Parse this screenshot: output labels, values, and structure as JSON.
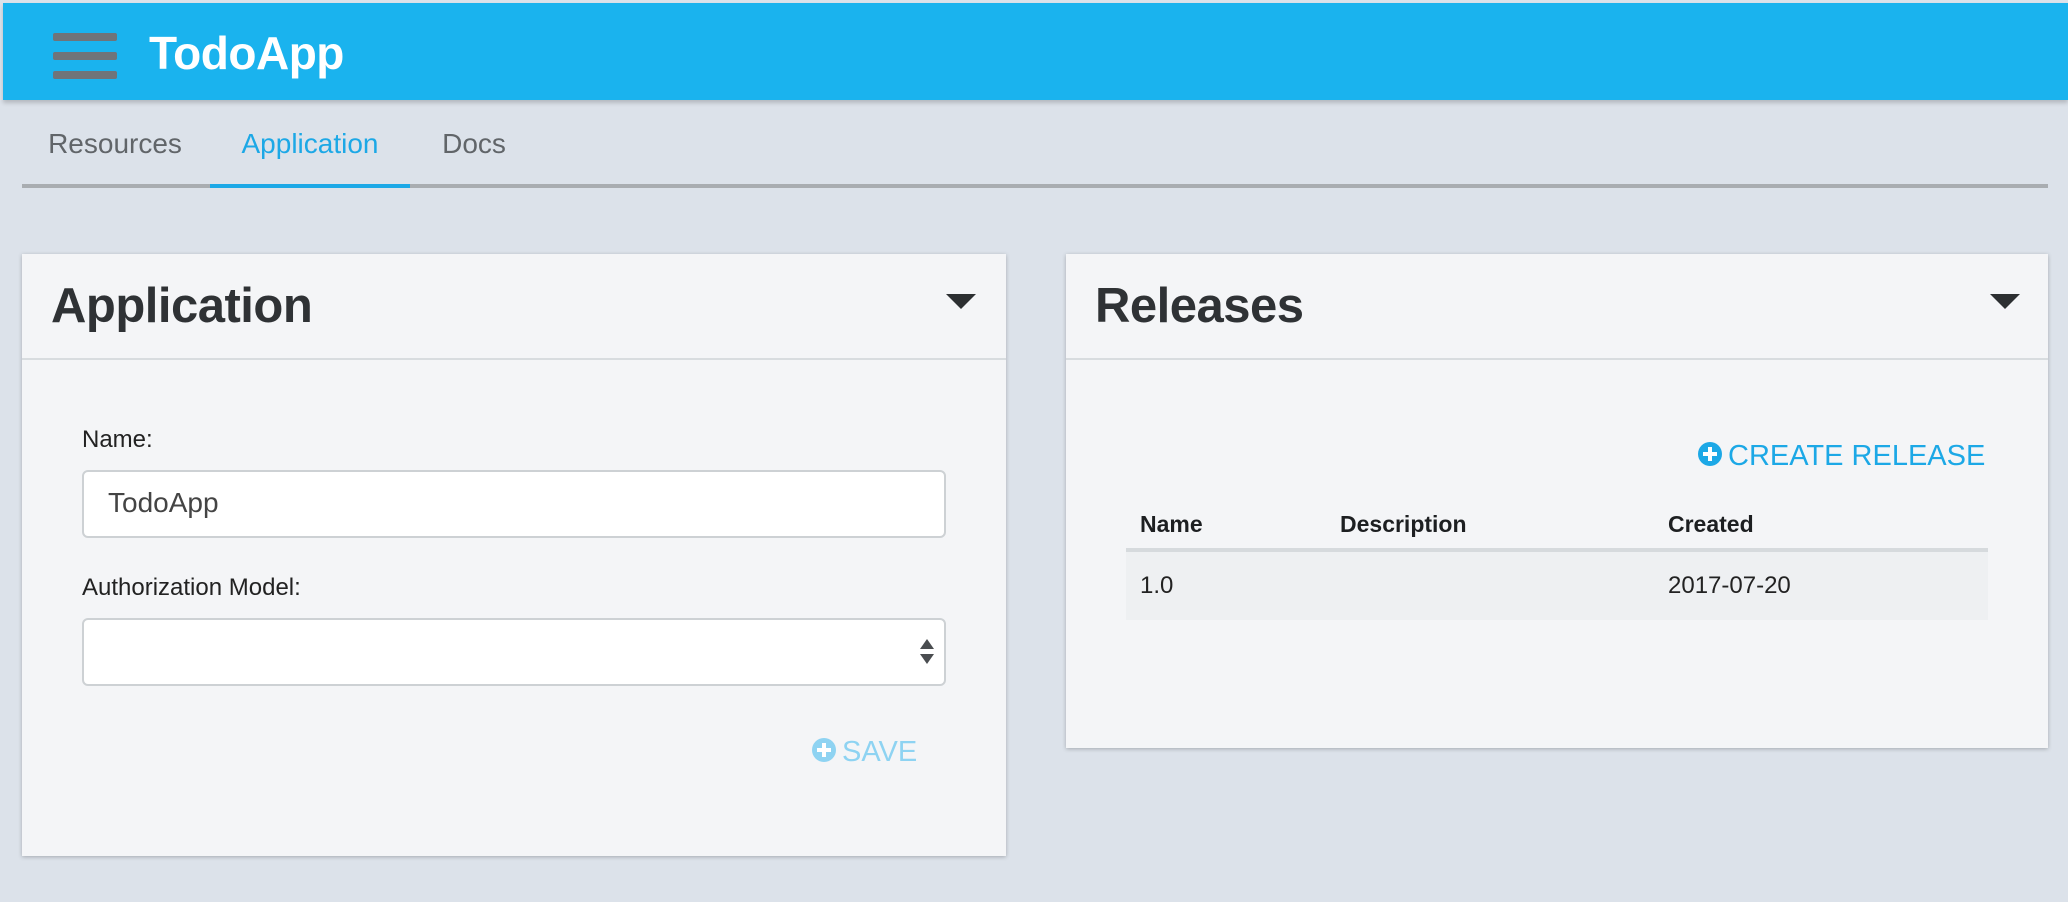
{
  "header": {
    "menu_icon": "hamburger-menu-icon",
    "title": "TodoApp",
    "background": "#1ab3ee"
  },
  "tabs": [
    {
      "label": "Resources",
      "active": false
    },
    {
      "label": "Application",
      "active": true
    },
    {
      "label": "Docs",
      "active": false
    }
  ],
  "application_panel": {
    "title": "Application",
    "collapse_icon": "caret-down-icon",
    "name_label": "Name:",
    "name_value": "TodoApp",
    "auth_label": "Authorization Model:",
    "auth_value": "",
    "save_icon": "plus-circle-icon",
    "save_label": "SAVE"
  },
  "releases_panel": {
    "title": "Releases",
    "collapse_icon": "caret-down-icon",
    "create_icon": "plus-circle-icon",
    "create_label": "CREATE RELEASE",
    "columns": [
      "Name",
      "Description",
      "Created"
    ],
    "rows": [
      {
        "name": "1.0",
        "description": "",
        "created": "2017-07-20"
      }
    ]
  },
  "colors": {
    "accent": "#1ca8e6",
    "disabled_accent": "#8ed3f2",
    "page_bg": "#dce2ea"
  }
}
